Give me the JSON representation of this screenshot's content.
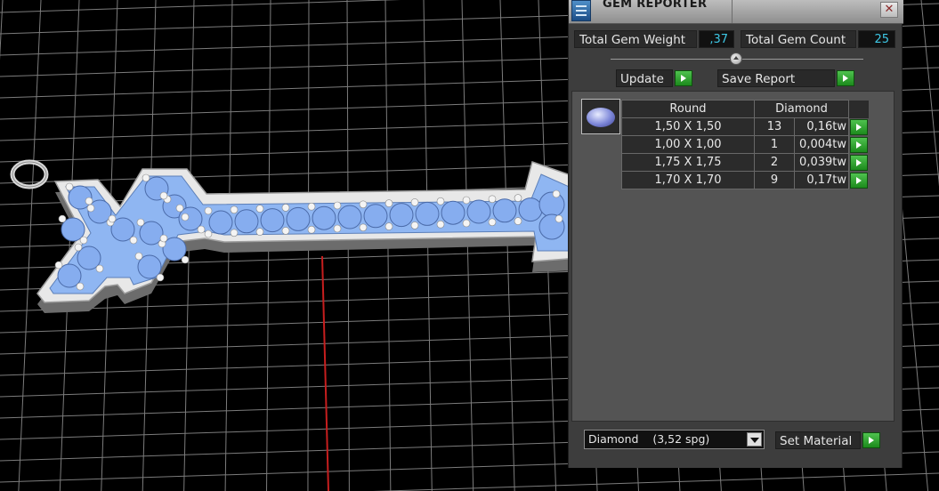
{
  "panel": {
    "title": "GEM REPORTER",
    "close_glyph": "✕",
    "icon": "gem-reporter-app-icon",
    "total_weight_label": "Total Gem Weight",
    "total_weight_value": ",37",
    "total_count_label": "Total Gem Count",
    "total_count_value": "25",
    "update_label": "Update",
    "save_report_label": "Save Report",
    "table": {
      "shape": "Round",
      "material": "Diamond",
      "rows": [
        {
          "size": "1,50 X 1,50",
          "count": "13",
          "weight": "0,16tw"
        },
        {
          "size": "1,00 X 1,00",
          "count": "1",
          "weight": "0,004tw"
        },
        {
          "size": "1,75 X 1,75",
          "count": "2",
          "weight": "0,039tw"
        },
        {
          "size": "1,70 X 1,70",
          "count": "9",
          "weight": "0,17tw"
        }
      ]
    },
    "material_select_value": "Diamond    (3,52 spg)",
    "set_material_label": "Set Material"
  },
  "colors": {
    "panel_bg": "#3d3d3d",
    "value_cyan": "#3ec8e6",
    "go_green": "#1c8a1c",
    "gem_blue": "#8fb6f2",
    "axis_red": "#c61e1e"
  }
}
